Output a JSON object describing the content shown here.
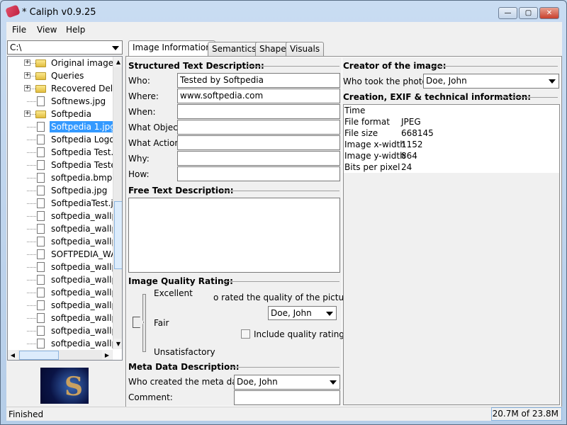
{
  "window": {
    "title": "* Caliph v0.9.25",
    "controls": [
      "minimize",
      "maximize",
      "close"
    ]
  },
  "menu": [
    "File",
    "View",
    "Help"
  ],
  "drive_combo": "C:\\",
  "tree": [
    {
      "label": "Original images",
      "type": "folder"
    },
    {
      "label": "Queries",
      "type": "folder"
    },
    {
      "label": "Recovered Delet",
      "type": "folder"
    },
    {
      "label": "Softnews.jpg",
      "type": "file"
    },
    {
      "label": "Softpedia",
      "type": "folder"
    },
    {
      "label": "Softpedia 1.jpg",
      "type": "file",
      "selected": true
    },
    {
      "label": "Softpedia Logo.j",
      "type": "file"
    },
    {
      "label": "Softpedia Test.jp",
      "type": "file"
    },
    {
      "label": "Softpedia Testec",
      "type": "file"
    },
    {
      "label": "softpedia.bmp",
      "type": "file"
    },
    {
      "label": "Softpedia.jpg",
      "type": "file"
    },
    {
      "label": "SoftpediaTest.jp",
      "type": "file"
    },
    {
      "label": "softpedia_wallpa",
      "type": "file"
    },
    {
      "label": "softpedia_wallpa",
      "type": "file"
    },
    {
      "label": "softpedia_wallpa",
      "type": "file"
    },
    {
      "label": "SOFTPEDIA_WAI",
      "type": "file"
    },
    {
      "label": "softpedia_wallpa",
      "type": "file"
    },
    {
      "label": "softpedia_wallpa",
      "type": "file"
    },
    {
      "label": "softpedia_wallpa",
      "type": "file"
    },
    {
      "label": "softpedia_wallpa",
      "type": "file"
    },
    {
      "label": "softpedia_wallpa",
      "type": "file"
    },
    {
      "label": "softpedia_wallpa",
      "type": "file"
    },
    {
      "label": "softpedia_wallpa",
      "type": "file"
    }
  ],
  "tabs": [
    "Image Information",
    "Semantics",
    "Shape",
    "Visuals"
  ],
  "structured": {
    "heading": "Structured Text Description:",
    "fields": [
      {
        "label": "Who:",
        "value": "Tested by Softpedia"
      },
      {
        "label": "Where:",
        "value": "www.softpedia.com"
      },
      {
        "label": "When:",
        "value": ""
      },
      {
        "label": "What Object:",
        "value": ""
      },
      {
        "label": "What Action:",
        "value": ""
      },
      {
        "label": "Why:",
        "value": ""
      },
      {
        "label": "How:",
        "value": ""
      }
    ]
  },
  "free_text": {
    "heading": "Free Text Description:",
    "value": ""
  },
  "quality": {
    "heading": "Image Quality Rating:",
    "levels": [
      "Excellent",
      "Fair",
      "Unsatisfactory"
    ],
    "slider_value": "Fair",
    "rater_label": "o rated the quality of the picture:",
    "rater": "Doe, John",
    "include_label": "Include quality rating",
    "include_checked": false
  },
  "meta": {
    "heading": "Meta Data Description:",
    "creator_label": "Who created the meta data:",
    "creator": "Doe, John",
    "comment_label": "Comment:",
    "comment": ""
  },
  "creator": {
    "heading": "Creator of the image:",
    "who_label": "Who took the photo:",
    "who": "Doe, John"
  },
  "exif": {
    "heading": "Creation, EXIF & technical information:",
    "rows": [
      {
        "key": "Time",
        "value": ""
      },
      {
        "key": "File format",
        "value": "JPEG"
      },
      {
        "key": "File size",
        "value": "668145"
      },
      {
        "key": "Image x-width",
        "value": "1152"
      },
      {
        "key": "Image y-width",
        "value": "864"
      },
      {
        "key": "Bits per pixel",
        "value": "24"
      }
    ]
  },
  "status": {
    "text": "Finished",
    "memory": "20.7M of 23.8M"
  },
  "colors": {
    "selection": "#3399ff",
    "window_frame": "#c4d8ee"
  }
}
